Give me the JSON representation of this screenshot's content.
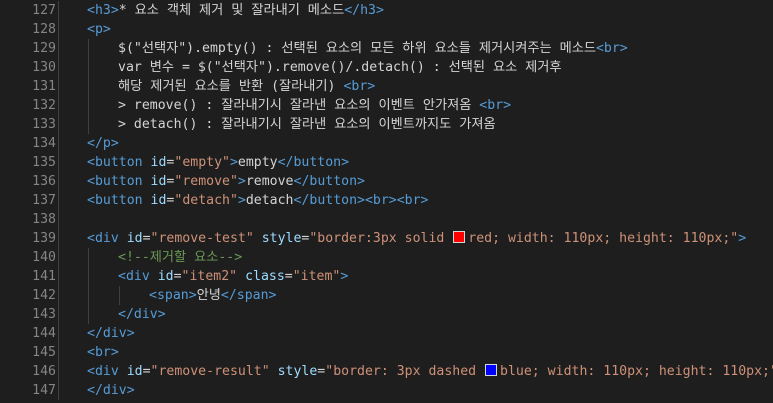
{
  "lines": [
    {
      "n": "127",
      "indent": 0,
      "tokens": [
        [
          "tag",
          "<h3>"
        ],
        [
          "txt",
          "* 요소 객체 제거 및 잘라내기 메소드"
        ],
        [
          "tag",
          "</h3>"
        ]
      ]
    },
    {
      "n": "128",
      "indent": 0,
      "tokens": [
        [
          "tag",
          "<p>"
        ]
      ]
    },
    {
      "n": "129",
      "indent": 1,
      "tokens": [
        [
          "txt",
          "$(\"선택자\").empty() : 선택된 요소의 모든 하위 요소들 제거시켜주는 메소드"
        ],
        [
          "tag",
          "<br>"
        ]
      ]
    },
    {
      "n": "130",
      "indent": 1,
      "tokens": [
        [
          "txt",
          "var 변수 = $(\"선택자\").remove()/.detach() : 선택된 요소 제거후"
        ]
      ]
    },
    {
      "n": "131",
      "indent": 1,
      "tokens": [
        [
          "txt",
          "해당 제거된 요소를 반환 (잘라내기) "
        ],
        [
          "tag",
          "<br>"
        ]
      ]
    },
    {
      "n": "132",
      "indent": 1,
      "tokens": [
        [
          "txt",
          "> remove() : 잘라내기시 잘라낸 요소의 이벤트 안가져옴 "
        ],
        [
          "tag",
          "<br>"
        ]
      ]
    },
    {
      "n": "133",
      "indent": 1,
      "tokens": [
        [
          "txt",
          "> detach() : 잘라내기시 잘라낸 요소의 이벤트까지도 가져옴"
        ]
      ]
    },
    {
      "n": "134",
      "indent": 0,
      "tokens": [
        [
          "tag",
          "</p>"
        ]
      ]
    },
    {
      "n": "135",
      "indent": 0,
      "tokens": [
        [
          "tag",
          "<button "
        ],
        [
          "attr",
          "id"
        ],
        [
          "txt",
          "="
        ],
        [
          "str",
          "\"empty\""
        ],
        [
          "tag",
          ">"
        ],
        [
          "txt",
          "empty"
        ],
        [
          "tag",
          "</button>"
        ]
      ]
    },
    {
      "n": "136",
      "indent": 0,
      "tokens": [
        [
          "tag",
          "<button "
        ],
        [
          "attr",
          "id"
        ],
        [
          "txt",
          "="
        ],
        [
          "str",
          "\"remove\""
        ],
        [
          "tag",
          ">"
        ],
        [
          "txt",
          "remove"
        ],
        [
          "tag",
          "</button>"
        ]
      ]
    },
    {
      "n": "137",
      "indent": 0,
      "tokens": [
        [
          "tag",
          "<button "
        ],
        [
          "attr",
          "id"
        ],
        [
          "txt",
          "="
        ],
        [
          "str",
          "\"detach\""
        ],
        [
          "tag",
          ">"
        ],
        [
          "txt",
          "detach"
        ],
        [
          "tag",
          "</button><br><br>"
        ]
      ]
    },
    {
      "n": "138",
      "indent": 0,
      "tokens": []
    },
    {
      "n": "139",
      "indent": 0,
      "tokens": [
        [
          "tag",
          "<div "
        ],
        [
          "attr",
          "id"
        ],
        [
          "txt",
          "="
        ],
        [
          "str",
          "\"remove-test\" "
        ],
        [
          "attr",
          "style"
        ],
        [
          "txt",
          "="
        ],
        [
          "str",
          "\"border:3px solid "
        ],
        [
          "swatch",
          "#ff0000"
        ],
        [
          "str",
          "red; width: 110px; height: 110px;\""
        ],
        [
          "tag",
          ">"
        ]
      ]
    },
    {
      "n": "140",
      "indent": 1,
      "tokens": [
        [
          "cmt",
          "<!--제거할 요소-->"
        ]
      ]
    },
    {
      "n": "141",
      "indent": 1,
      "tokens": [
        [
          "tag",
          "<div "
        ],
        [
          "attr",
          "id"
        ],
        [
          "txt",
          "="
        ],
        [
          "str",
          "\"item2\" "
        ],
        [
          "attr",
          "class"
        ],
        [
          "txt",
          "="
        ],
        [
          "str",
          "\"item\""
        ],
        [
          "tag",
          ">"
        ]
      ]
    },
    {
      "n": "142",
      "indent": 2,
      "tokens": [
        [
          "tag",
          "<span>"
        ],
        [
          "txt",
          "안녕"
        ],
        [
          "tag",
          "</span>"
        ]
      ]
    },
    {
      "n": "143",
      "indent": 1,
      "tokens": [
        [
          "tag",
          "</div>"
        ]
      ]
    },
    {
      "n": "144",
      "indent": 0,
      "tokens": [
        [
          "tag",
          "</div>"
        ]
      ]
    },
    {
      "n": "145",
      "indent": 0,
      "tokens": [
        [
          "tag",
          "<br>"
        ]
      ]
    },
    {
      "n": "146",
      "indent": 0,
      "tokens": [
        [
          "tag",
          "<div "
        ],
        [
          "attr",
          "id"
        ],
        [
          "txt",
          "="
        ],
        [
          "str",
          "\"remove-result\" "
        ],
        [
          "attr",
          "style"
        ],
        [
          "txt",
          "="
        ],
        [
          "str",
          "\"border: 3px dashed "
        ],
        [
          "swatch",
          "#0000ff"
        ],
        [
          "str",
          "blue; width: 110px; height: 110px;\""
        ],
        [
          "tag",
          ">"
        ]
      ]
    },
    {
      "n": "147",
      "indent": 0,
      "tokens": [
        [
          "tag",
          "</div>"
        ]
      ]
    }
  ]
}
